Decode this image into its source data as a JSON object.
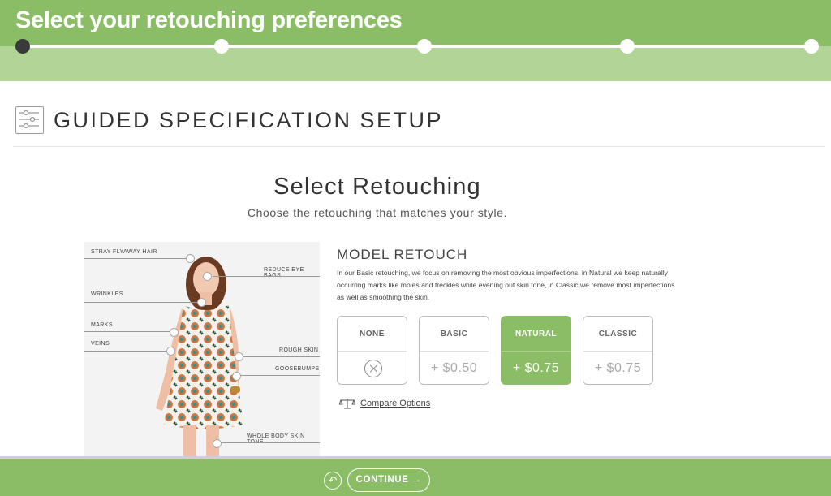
{
  "header": {
    "title": "Select your retouching preferences"
  },
  "section": {
    "title": "GUIDED SPECIFICATION SETUP"
  },
  "main": {
    "title": "Select Retouching",
    "subtitle": "Choose the retouching that matches your style."
  },
  "model": {
    "labels": {
      "stray": "STRAY FLYAWAY HAIR",
      "eyebags": "REDUCE EYE BAGS",
      "wrinkles": "WRINKLES",
      "marks": "MARKS",
      "veins": "VEINS",
      "rough": "ROUGH SKIN",
      "goosebumps": "GOOSEBUMPS",
      "wholebody": "WHOLE BODY SKIN TONE"
    }
  },
  "retouch": {
    "heading": "MODEL RETOUCH",
    "description": "In our Basic retouching, we focus on removing the most obvious imperfections, in Natural we keep naturally occurring marks like moles and freckles while evening out skin tone, in Classic we remove most imperfections as well as smoothing the skin.",
    "options": [
      {
        "name": "NONE",
        "price": ""
      },
      {
        "name": "BASIC",
        "price": "+ $0.50"
      },
      {
        "name": "NATURAL",
        "price": "+ $0.75"
      },
      {
        "name": "CLASSIC",
        "price": "+ $0.75"
      }
    ],
    "selected": "NATURAL",
    "compare_label": "Compare Options"
  },
  "footer": {
    "continue_label": "CONTINUE →"
  },
  "colors": {
    "accent": "#8bbd66",
    "accent_light": "#b2d496",
    "active_step": "#3a3a3a"
  },
  "icons": [
    "sliders-icon",
    "scale-icon",
    "close-circle-icon",
    "back-arrow-icon"
  ]
}
